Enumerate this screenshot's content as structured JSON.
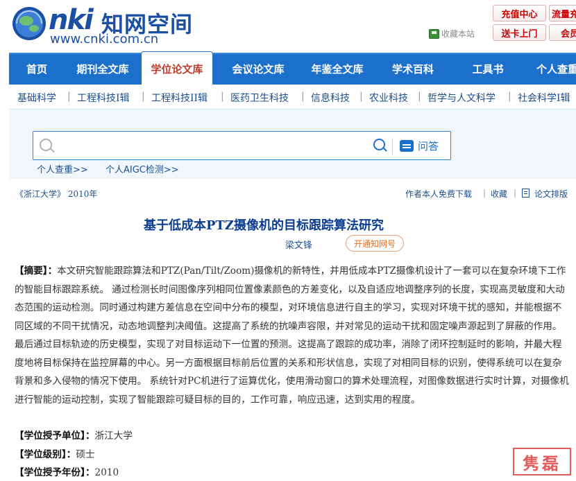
{
  "header": {
    "logo_nki": "nki",
    "logo_cn": "知网空间",
    "logo_url": "www.cnki.com.cn",
    "bookmark_label": "收藏本站",
    "buttons": [
      "充值中心",
      "流量充值",
      "送卡上门",
      "会员"
    ]
  },
  "nav": {
    "items": [
      "首页",
      "期刊全文库",
      "学位论文库",
      "会议论文库",
      "年鉴全文库",
      "学术百科",
      "工具书",
      "个人查重"
    ],
    "active": "学位论文库"
  },
  "subnav": {
    "items": [
      "基础科学",
      "工程科技I辑",
      "工程科技II辑",
      "医药卫生科技",
      "信息科技",
      "农业科技",
      "哲学与人文科学",
      "社会科学I辑"
    ]
  },
  "search": {
    "value": "",
    "ask_label": "问答",
    "quick_links": [
      "个人查重>>",
      "个人AIGC检测>>"
    ]
  },
  "meta": {
    "source": "《浙江大学》 2010年",
    "links": [
      "作者本人免费下载",
      "收藏",
      "论文排版"
    ]
  },
  "paper": {
    "title": "基于低成本PTZ摄像机的目标跟踪算法研究",
    "author": "梁文锋",
    "open_button": "开通知网号",
    "abstract_label": "【摘要】：",
    "abstract": "本文研究智能跟踪算法和PTZ(Pan/Tilt/Zoom)摄像机的新特性，并用低成本PTZ摄像机设计了一套可以在复杂环境下工作的智能目标跟踪系统。 通过检测长时间图像序列相同位置像素颜色的方差变化，以及自适应地调整序列的长度，实现高灵敏度和大动态范围的运动检测。同时通过构建方差信息在空间中分布的模型，对环境信息进行自主的学习，实现对环境干扰的感知，并能根据不同区域的不同干扰情况，动态地调整判决阈值。这提高了系统的抗噪声容限，并对常见的运动干扰和固定噪声源起到了屏蔽的作用。最后通过目标轨迹的历史模型，实现了对目标运动下一位置的预测。这提高了跟踪的成功率，消除了闭环控制延时的影响，并最大程度地将目标保持在监控屏幕的中心。另一方面根据目标前后位置的关系和形状信息，实现了对相同目标的识别，使得系统可以在复杂背景和多入侵物的情况下使用。 系统针对PC机进行了运算优化，使用滑动窗口的算术处理流程，对图像数据进行实时计算，对摄像机进行智能的运动控制，实现了智能跟踪可疑目标的目的，工作可靠，响应迅速，达到实用的程度。",
    "fields": [
      {
        "label": "【学位授予单位】：",
        "value": "浙江大学"
      },
      {
        "label": "【学位级别】：",
        "value": "硕士"
      },
      {
        "label": "【学位授予年份】：",
        "value": "2010"
      }
    ]
  },
  "stamp": "隽磊",
  "colors": {
    "nav_bg": "#1c6fcb",
    "active_tab_text": "#c0392b",
    "link": "#1c4f8f",
    "title": "#0b3d91",
    "accent_orange": "#e07020",
    "button_red": "#cc0000"
  }
}
